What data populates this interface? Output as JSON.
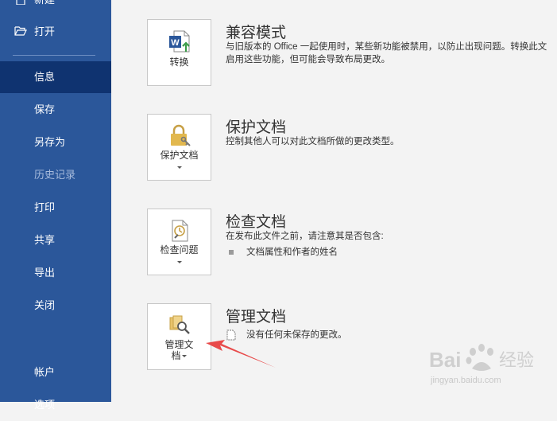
{
  "sidebar": {
    "new_label": "新建",
    "open_label": "打开",
    "info_label": "信息",
    "save_label": "保存",
    "save_as_label": "另存为",
    "history_label": "历史记录",
    "print_label": "打印",
    "share_label": "共享",
    "export_label": "导出",
    "close_label": "关闭",
    "account_label": "帐户",
    "options_label": "选项"
  },
  "sections": {
    "compat": {
      "button_label": "转换",
      "title": "兼容模式",
      "desc_line1": "与旧版本的 Office 一起使用时，某些新功能被禁用，以防止出现问题。转换此文",
      "desc_line2": "启用这些功能，但可能会导致布局更改。"
    },
    "protect": {
      "button_label": "保护文档",
      "title": "保护文档",
      "desc": "控制其他人可以对此文档所做的更改类型。"
    },
    "inspect": {
      "button_label": "检查问题",
      "title": "检查文档",
      "desc": "在发布此文件之前，请注意其是否包含:",
      "bullet": "文档属性和作者的姓名"
    },
    "manage": {
      "button_label_1": "管理文",
      "button_label_2": "档",
      "title": "管理文档",
      "desc": "没有任何未保存的更改。"
    }
  },
  "watermark": {
    "brand": "Bai",
    "brand_cn": "经验",
    "url": "jingyan.baidu.com"
  },
  "colors": {
    "sidebar": "#2b579a",
    "sidebar_active": "#0f3370",
    "arrow": "#e84a4a"
  }
}
